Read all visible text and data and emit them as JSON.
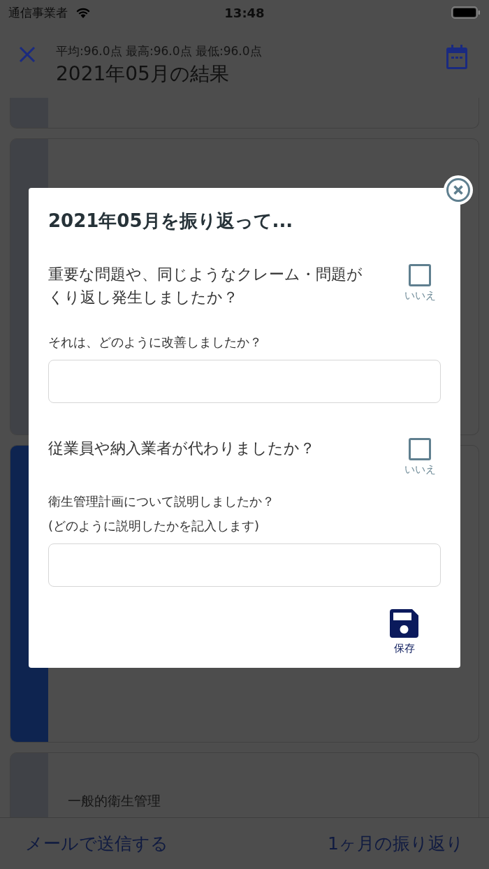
{
  "status_bar": {
    "carrier": "通信事業者",
    "time": "13:48"
  },
  "header": {
    "stats": "平均:96.0点 最高:96.0点 最低:96.0点",
    "title": "2021年05月の結果"
  },
  "cards": [
    {
      "color": "#404247"
    },
    {
      "color": "#404247"
    },
    {
      "color": "#0e2450"
    },
    {
      "color": "#404247",
      "label": "一般的衛生管理"
    }
  ],
  "bottom_bar": {
    "buttons": [
      "メールで送信する",
      "1ヶ月の振り返り"
    ]
  },
  "dialog": {
    "title": "2021年05月を振り返って...",
    "items": [
      {
        "kind": "checkbox",
        "question": "重要な問題や、同じようなクレーム・問題がくり返し発生しましたか？",
        "checked": false,
        "label": "いいえ"
      },
      {
        "kind": "field",
        "prompt_lines": [
          "それは、どのように改善しましたか？"
        ]
      },
      {
        "kind": "checkbox",
        "question": "従業員や納入業者が代わりましたか？",
        "checked": false,
        "label": "いいえ"
      },
      {
        "kind": "field",
        "prompt_lines": [
          "衛生管理計画について説明しましたか？",
          "(どのように説明したかを記入します)"
        ]
      }
    ],
    "save": "保存"
  }
}
